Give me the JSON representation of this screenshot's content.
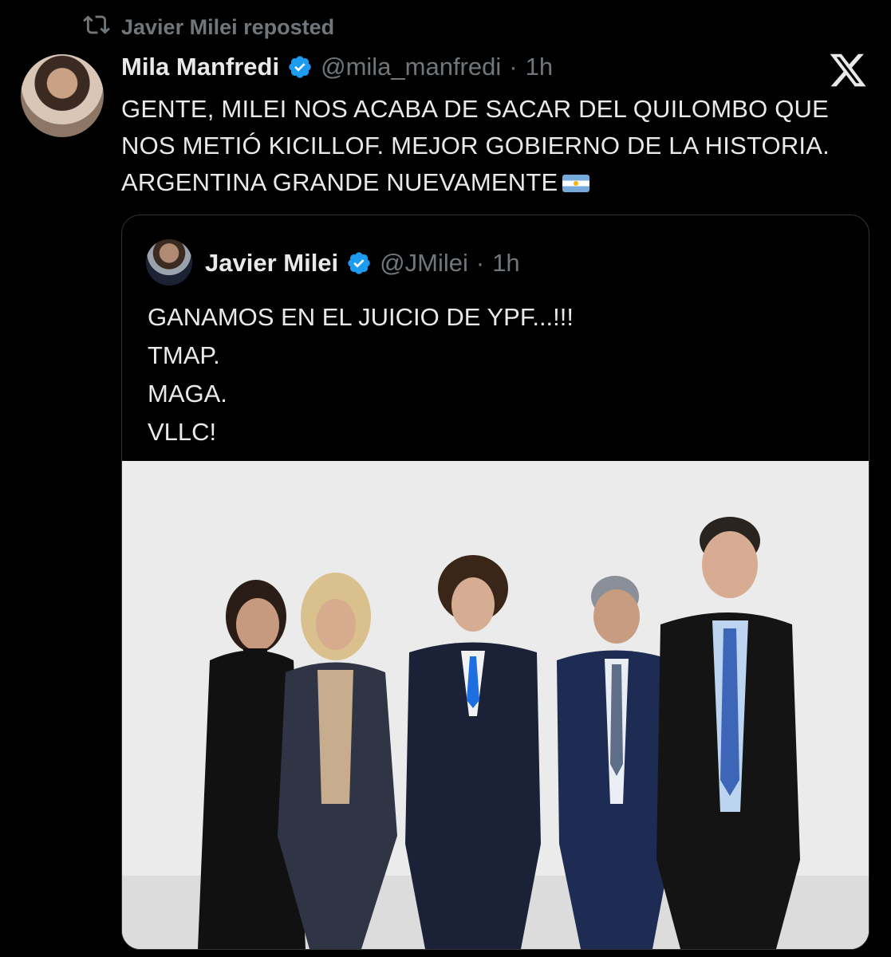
{
  "repost": {
    "label": "Javier Milei reposted",
    "icon": "repost-icon"
  },
  "tweet": {
    "author_name": "Mila Manfredi",
    "handle": "@mila_manfredi",
    "separator": "·",
    "time": "1h",
    "text": "GENTE, MILEI NOS ACABA DE SACAR DEL QUILOMBO QUE NOS METIÓ KICILLOF. MEJOR GOBIERNO DE LA HISTORIA. ARGENTINA GRANDE NUEVAMENTE",
    "emoji": "argentina-flag-icon",
    "verified": true
  },
  "quoted_tweet": {
    "author_name": "Javier Milei",
    "handle": "@JMilei",
    "separator": "·",
    "time": "1h",
    "lines": [
      "GANAMOS EN EL JUICIO DE YPF...!!!",
      "TMAP.",
      "MAGA.",
      "VLLC!"
    ],
    "verified": true,
    "media": "photo-five-people-thumbs-up"
  },
  "brand": {
    "logo": "x-logo-icon",
    "verified_color": "#1d9bf0",
    "text_color": "#e7e9ea",
    "muted_color": "#71767b"
  }
}
